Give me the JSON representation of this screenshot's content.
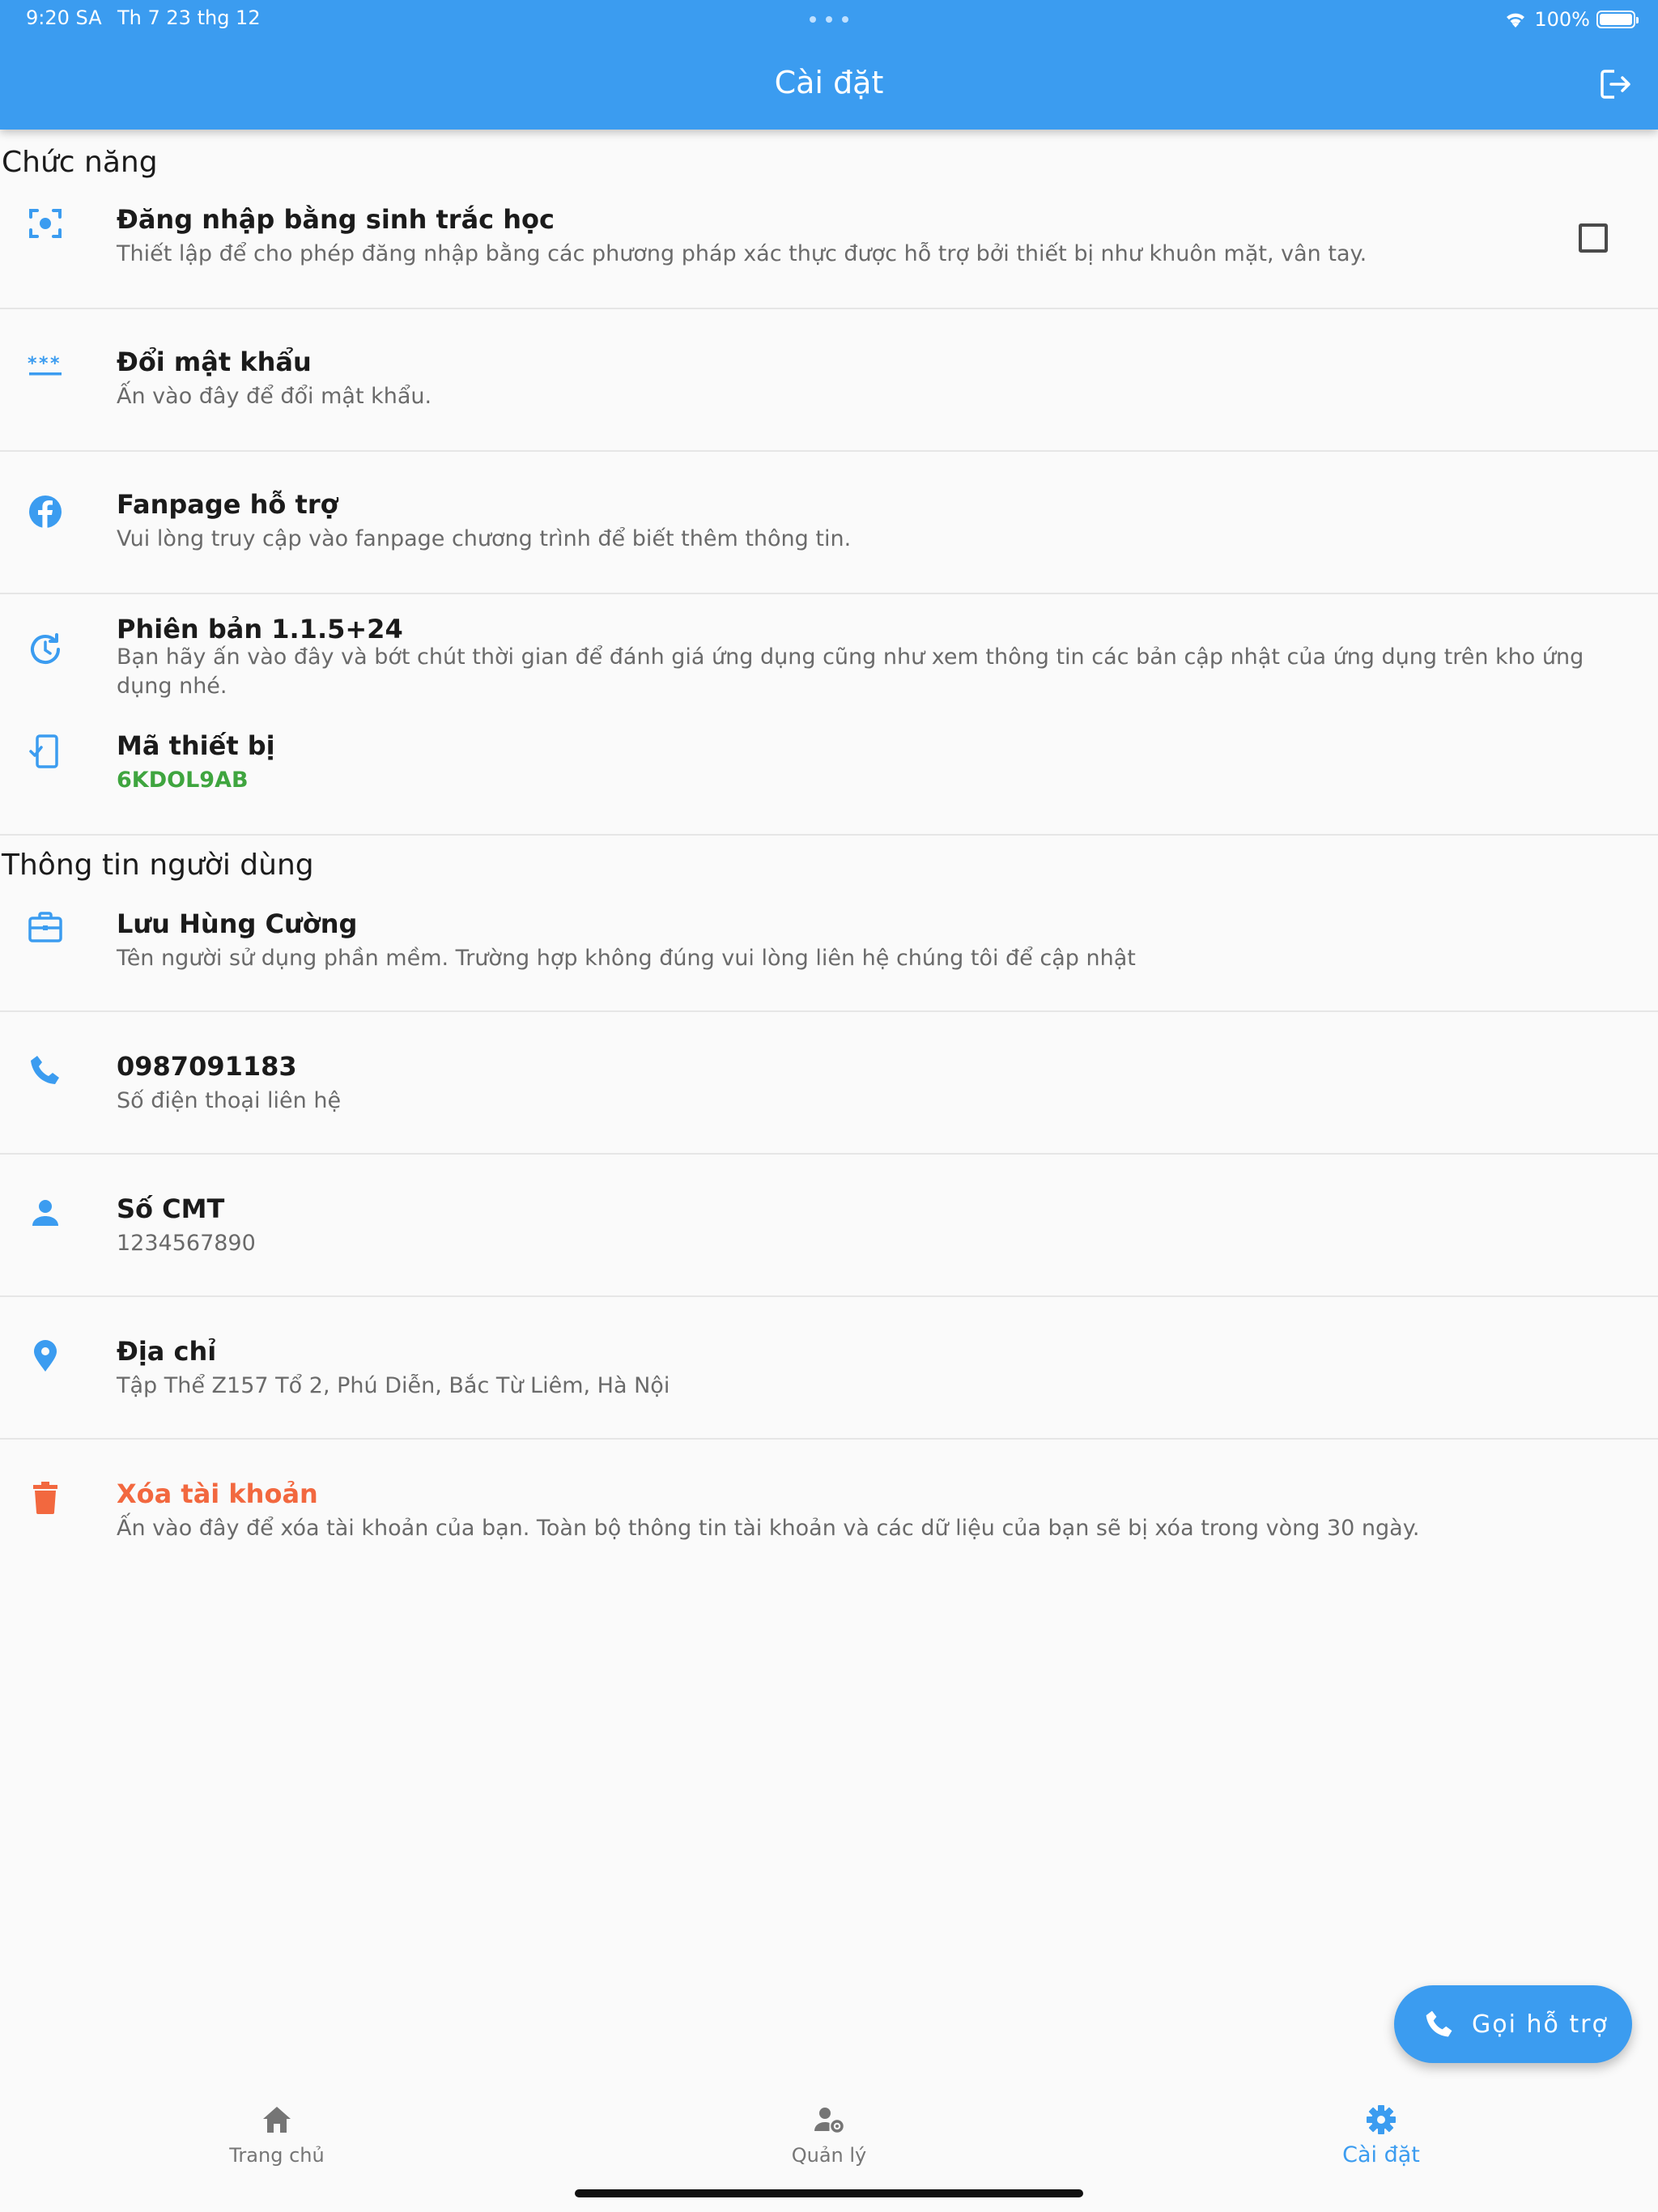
{
  "status_bar": {
    "time": "9:20 SA",
    "date": "Th 7 23 thg 12",
    "battery": "100%",
    "battery_level": 1.0
  },
  "header": {
    "title": "Cài đặt"
  },
  "sections": {
    "features": {
      "title": "Chức năng",
      "biometric": {
        "title": "Đăng nhập bằng sinh trắc học",
        "subtitle": "Thiết lập để cho phép đăng nhập bằng các phương pháp xác thực được hỗ trợ bởi thiết bị như khuôn mặt, vân tay.",
        "checked": false
      },
      "change_password": {
        "title": "Đổi mật khẩu",
        "subtitle": "Ấn vào đây để đổi mật khẩu."
      },
      "fanpage": {
        "title": "Fanpage hỗ trợ",
        "subtitle": "Vui lòng truy cập vào fanpage chương trình để biết thêm thông tin."
      },
      "version": {
        "title": "Phiên bản 1.1.5+24",
        "subtitle": "Bạn hãy ấn vào đây và bớt chút thời gian để đánh giá ứng dụng cũng như xem thông tin các bản cập nhật của ứng dụng trên kho ứng dụng nhé."
      },
      "device": {
        "title": "Mã thiết bị",
        "code": "6KDOL9AB"
      }
    },
    "user_info": {
      "title": "Thông tin người dùng",
      "name": {
        "title": "Lưu Hùng Cường",
        "subtitle": "Tên người sử dụng phần mềm. Trường hợp không đúng vui lòng liên hệ chúng tôi để cập nhật"
      },
      "phone": {
        "title": "0987091183",
        "subtitle": "Số điện thoại liên hệ"
      },
      "id_card": {
        "title": "Số CMT",
        "subtitle": "1234567890"
      },
      "address": {
        "title": "Địa chỉ",
        "subtitle": "Tập Thể Z157 Tổ 2, Phú Diễn, Bắc Từ Liêm, Hà Nội"
      },
      "delete_account": {
        "title": "Xóa tài khoản",
        "subtitle": "Ấn vào đây để xóa tài khoản của bạn. Toàn bộ thông tin tài khoản và các dữ liệu của bạn sẽ bị xóa trong vòng 30 ngày."
      }
    }
  },
  "fab": {
    "label": "Gọi hỗ trợ"
  },
  "bottom_nav": {
    "home": "Trang chủ",
    "manage": "Quản lý",
    "settings": "Cài đặt"
  },
  "colors": {
    "primary": "#3b9cf0",
    "success": "#3fa53f",
    "danger": "#f2683f"
  },
  "icons": {
    "biometric": "face-scan-icon",
    "password": "password-icon",
    "fanpage": "facebook-icon",
    "version": "update-icon",
    "device": "device-icon",
    "name": "briefcase-icon",
    "phone": "phone-icon",
    "id_card": "person-icon",
    "address": "location-pin-icon",
    "delete": "trash-icon",
    "logout": "logout-icon"
  }
}
